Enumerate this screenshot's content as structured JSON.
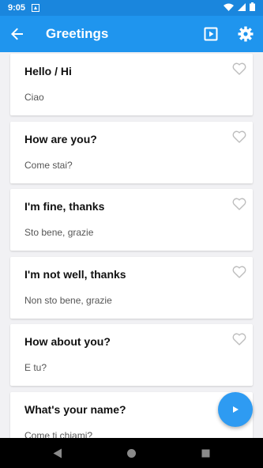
{
  "status_bar": {
    "time": "9:05",
    "icons": [
      "notification-icon",
      "wifi-icon",
      "signal-icon",
      "battery-icon"
    ]
  },
  "app_bar": {
    "title": "Greetings",
    "back_icon": "arrow-back-icon",
    "actions": [
      "play-slideshow-icon",
      "settings-gear-icon"
    ]
  },
  "phrases": [
    {
      "english": "Hello / Hi",
      "italian": "Ciao"
    },
    {
      "english": "How are you?",
      "italian": "Come stai?"
    },
    {
      "english": "I'm fine, thanks",
      "italian": "Sto bene, grazie"
    },
    {
      "english": "I'm not well, thanks",
      "italian": "Non sto bene, grazie"
    },
    {
      "english": "How about you?",
      "italian": "E tu?"
    },
    {
      "english": "What's your name?",
      "italian": "Come ti chiami?"
    }
  ],
  "fab": {
    "icon": "play-icon"
  },
  "nav_bar": {
    "icons": [
      "back-triangle-icon",
      "home-circle-icon",
      "recents-square-icon"
    ]
  },
  "colors": {
    "status_bar": "#1a86dd",
    "app_bar": "#1f95ee",
    "fab": "#2e9bf2",
    "background": "#f1f1f4"
  }
}
